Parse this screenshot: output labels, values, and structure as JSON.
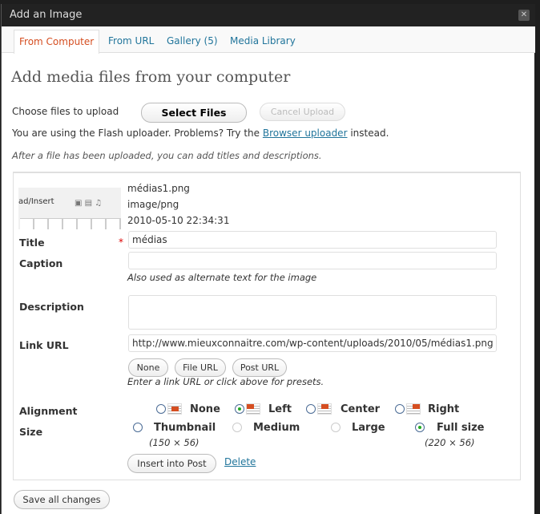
{
  "window": {
    "title": "Add an Image",
    "close_icon": "close-icon"
  },
  "tabs": [
    {
      "label": "From Computer",
      "active": true
    },
    {
      "label": "From URL"
    },
    {
      "label": "Gallery (5)"
    },
    {
      "label": "Media Library"
    }
  ],
  "heading": "Add media files from your computer",
  "upload": {
    "choose_label": "Choose files to upload",
    "select_button": "Select Files",
    "cancel_button": "Cancel Upload",
    "flash_text": "You are using the Flash uploader. Problems? Try the",
    "flash_link": "Browser uploader",
    "flash_after": "instead.",
    "note": "After a file has been uploaded, you can add titles and descriptions."
  },
  "file": {
    "thumbnail_text": "ad/Insert",
    "name": "médias1.png",
    "mime": "image/png",
    "date": "2010-05-10 22:34:31"
  },
  "form": {
    "title_label": "Title",
    "required_mark": "*",
    "title_value": "médias",
    "caption_label": "Caption",
    "caption_value": "",
    "caption_help": "Also used as alternate text for the image",
    "description_label": "Description",
    "description_value": "",
    "link_label": "Link URL",
    "link_value": "http://www.mieuxconnaitre.com/wp-content/uploads/2010/05/médias1.png",
    "link_buttons": [
      "None",
      "File URL",
      "Post URL"
    ],
    "link_help": "Enter a link URL or click above for presets.",
    "alignment_label": "Alignment",
    "alignment_options": [
      "None",
      "Left",
      "Center",
      "Right"
    ],
    "alignment_selected": "Left",
    "size_label": "Size",
    "size_options": [
      {
        "label": "Thumbnail",
        "dims": "(150 × 56)",
        "enabled": true
      },
      {
        "label": "Medium",
        "enabled": false
      },
      {
        "label": "Large",
        "enabled": false
      },
      {
        "label": "Full size",
        "dims": "(220 × 56)",
        "enabled": true
      }
    ],
    "size_selected": "Full size",
    "insert_button": "Insert into Post",
    "delete_link": "Delete"
  },
  "save_button": "Save all changes",
  "colors": {
    "accent": "#d54e21",
    "link": "#21759b",
    "titlebar": "#222222"
  }
}
